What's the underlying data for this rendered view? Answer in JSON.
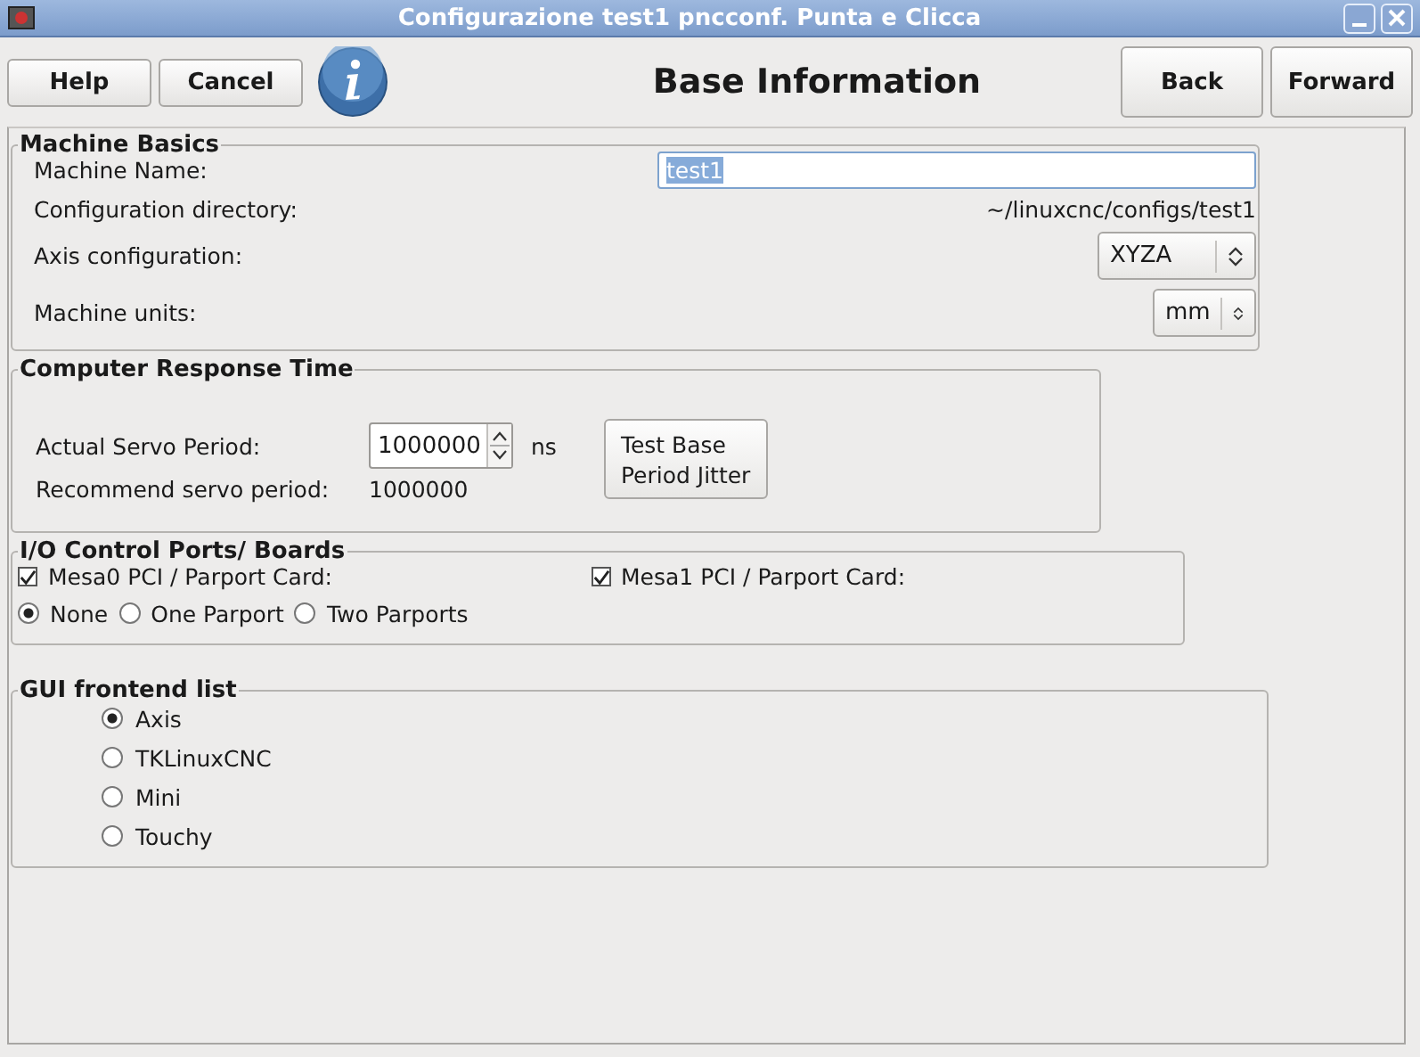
{
  "window": {
    "title": "Configurazione test1 pncconf. Punta e Clicca"
  },
  "toolbar": {
    "left_buttons": [
      "Help",
      "Cancel"
    ],
    "heading": "Base Information",
    "right_buttons": [
      "Back",
      "Forward"
    ]
  },
  "machine_basics": {
    "title": "Machine Basics",
    "name_label": "Machine Name:",
    "name_value": "test1",
    "name_text_selected": true,
    "dir_label": "Configuration directory:",
    "dir_value": "~/linuxcnc/configs/test1",
    "axis_label": "Axis configuration:",
    "axis_value": "XYZA",
    "units_label": "Machine units:",
    "units_value": "mm"
  },
  "response_time": {
    "title": "Computer Response Time",
    "servo_label": "Actual Servo Period:",
    "servo_value": "1000000",
    "servo_unit": "ns",
    "recommend_label": "Recommend servo period:",
    "recommend_value": "1000000",
    "test_button": "Test Base Period Jitter"
  },
  "io_ports": {
    "title": "I/O Control Ports/ Boards",
    "checkboxes": [
      {
        "label": "Mesa0 PCI / Parport Card:",
        "checked": true
      },
      {
        "label": "Mesa1 PCI / Parport Card:",
        "checked": true
      }
    ],
    "radios": [
      {
        "label": "None",
        "selected": true
      },
      {
        "label": "One Parport",
        "selected": false
      },
      {
        "label": "Two Parports",
        "selected": false
      }
    ]
  },
  "gui_frontend": {
    "title": "GUI frontend list",
    "options": [
      {
        "label": "Axis",
        "selected": true
      },
      {
        "label": "TKLinuxCNC",
        "selected": false
      },
      {
        "label": "Mini",
        "selected": false
      },
      {
        "label": "Touchy",
        "selected": false
      }
    ]
  }
}
